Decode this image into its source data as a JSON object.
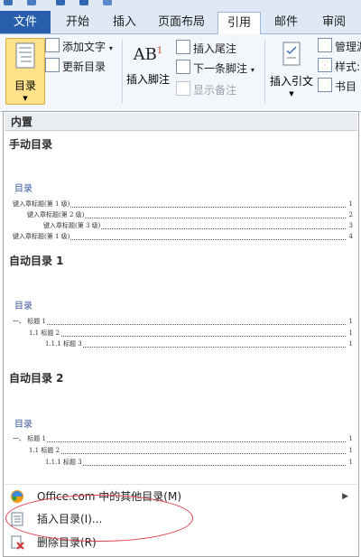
{
  "tabs": [
    {
      "label": "文件"
    },
    {
      "label": "开始"
    },
    {
      "label": "插入"
    },
    {
      "label": "页面布局"
    },
    {
      "label": "引用"
    },
    {
      "label": "邮件"
    },
    {
      "label": "审阅"
    }
  ],
  "ribbon": {
    "toc_button": "目录",
    "add_text": "添加文字",
    "update_toc": "更新目录",
    "insert_footnote": "插入脚注",
    "insert_endnote": "插入尾注",
    "next_footnote": "下一条脚注",
    "show_notes": "显示备注",
    "insert_citation": "插入引文",
    "manage_sources": "管理源",
    "style": "样式:",
    "bibliography": "书目"
  },
  "dropdown": {
    "section": "内置",
    "manual": {
      "title": "手动目录",
      "heading": "目录",
      "lines": [
        {
          "text": "键入章标题(第 1 级)",
          "page": "1"
        },
        {
          "text": "键入章标题(第 2 级)",
          "page": "2"
        },
        {
          "text": "键入章标题(第 3 级)",
          "page": "3"
        },
        {
          "text": "键入章标题(第 1 级)",
          "page": "4"
        }
      ]
    },
    "auto1": {
      "title": "自动目录 1",
      "heading": "目录",
      "lines": [
        {
          "text": "一、 标题 1",
          "page": "1"
        },
        {
          "text": "1.1 标题 2",
          "page": "1"
        },
        {
          "text": "1.1.1 标题 3",
          "page": "1"
        }
      ]
    },
    "auto2": {
      "title": "自动目录 2",
      "heading": "目录",
      "lines": [
        {
          "text": "一、 标题 1",
          "page": "1"
        },
        {
          "text": "1.1 标题 2",
          "page": "1"
        },
        {
          "text": "1.1.1 标题 3",
          "page": "1"
        }
      ]
    },
    "menu": {
      "more": "Office.com 中的其他目录(M)",
      "insert": "插入目录(I)...",
      "remove": "删除目录(R)"
    }
  }
}
